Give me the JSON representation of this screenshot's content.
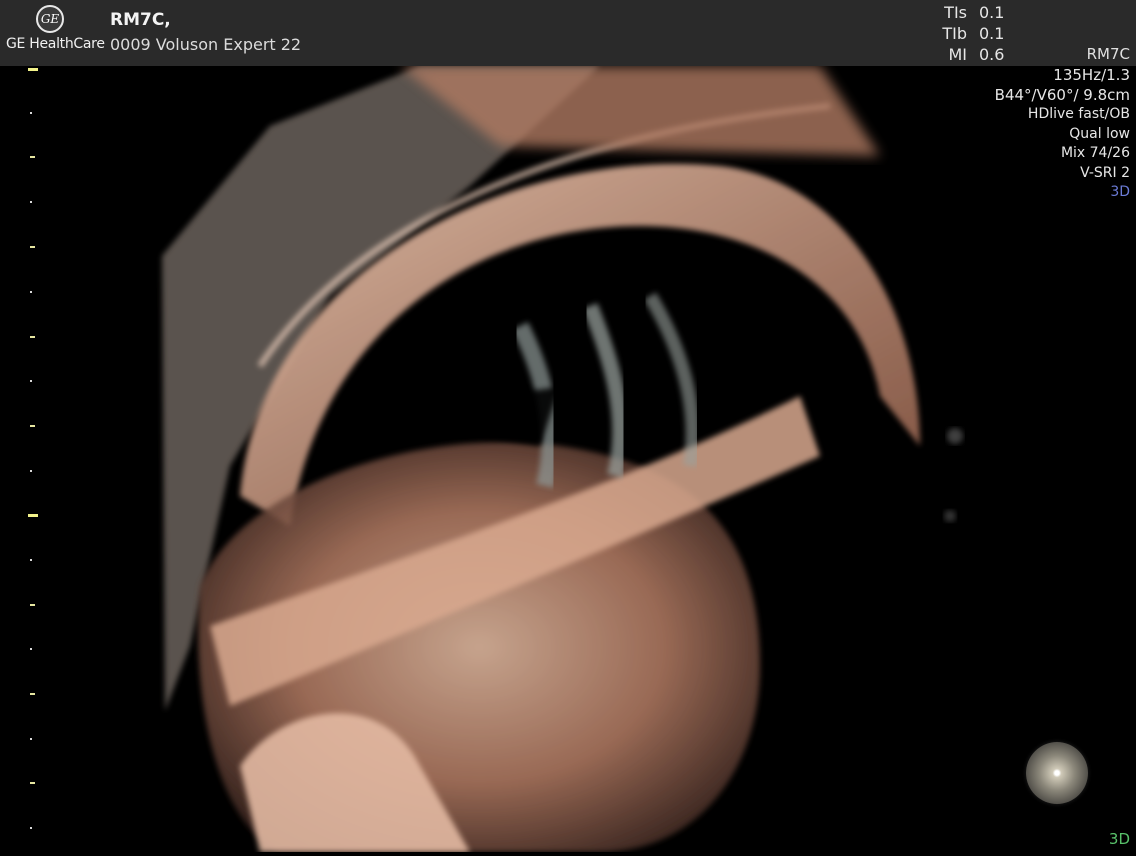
{
  "header": {
    "logo_text": "GE",
    "brand": "GE HealthCare",
    "patient": "RM7C,",
    "device": "0009 Voluson Expert 22"
  },
  "indices": [
    {
      "label": "TIs",
      "value": "0.1"
    },
    {
      "label": "TIb",
      "value": "0.1"
    },
    {
      "label": "MI",
      "value": "0.6"
    }
  ],
  "probe": "RM7C",
  "params": {
    "rate": "135Hz/1.3",
    "angles": "B44°/V60°/ 9.8cm",
    "render": "HDlive fast/OB",
    "quality": "Qual low",
    "mix": "Mix 74/26",
    "vsri": "V-SRI 2",
    "mode": "3D"
  },
  "footer": {
    "mode": "3D"
  },
  "colors": {
    "tissue_light": "#e8b8a0",
    "tissue_mid": "#b8806a",
    "tissue_dark": "#5a3a30",
    "mode_blue": "#6b7bd6",
    "mode_green": "#58c26a"
  }
}
